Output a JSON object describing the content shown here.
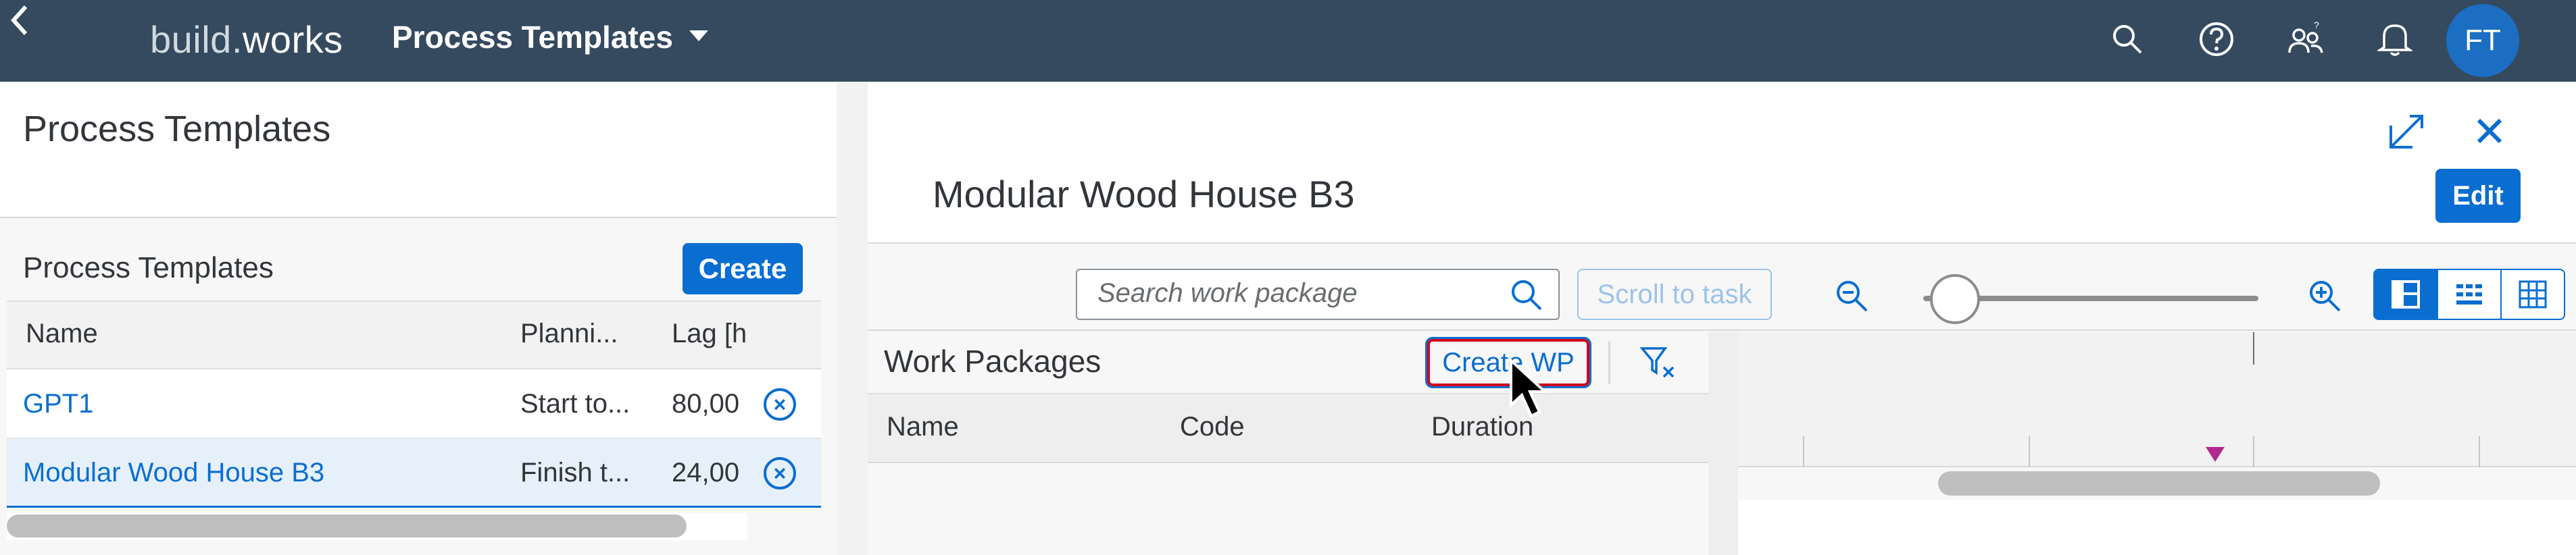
{
  "shell": {
    "logo_part1": "build.",
    "logo_part2": "works",
    "app_title": "Process Templates",
    "avatar_initials": "FT"
  },
  "left": {
    "page_title": "Process Templates",
    "section_title": "Process Templates",
    "create_label": "Create",
    "columns": [
      "Name",
      "Planni...",
      "Lag [h"
    ],
    "rows": [
      {
        "name": "GPT1",
        "planning": "Start to...",
        "lag": "80,00"
      },
      {
        "name": "Modular Wood House B3",
        "planning": "Finish t...",
        "lag": "24,00"
      }
    ]
  },
  "right": {
    "title": "Modular Wood House B3",
    "edit_label": "Edit",
    "search_placeholder": "Search work package",
    "scroll_to_task_label": "Scroll to task",
    "work_packages": {
      "title": "Work Packages",
      "create_wp_label": "Create WP",
      "columns": [
        "Name",
        "Code",
        "Duration"
      ]
    }
  },
  "colors": {
    "shell_bg": "#354a5f",
    "accent": "#0a6ed1",
    "milestone_marker": "#b0298d",
    "highlight_outline": "#d0021b"
  }
}
